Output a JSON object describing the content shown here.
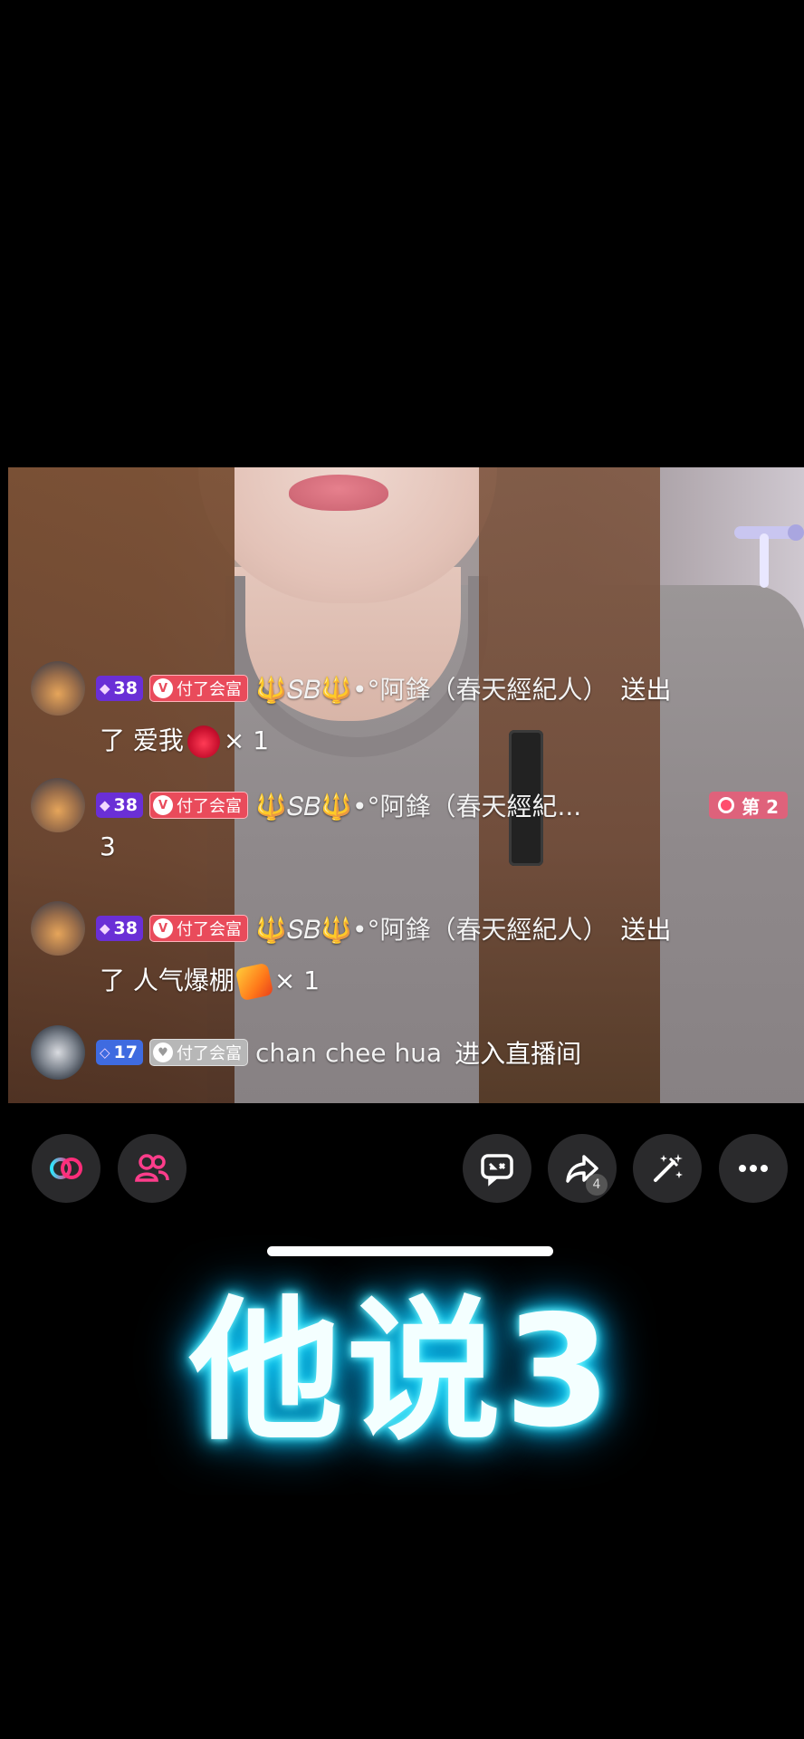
{
  "chat": [
    {
      "avatar": "sunset-avatar",
      "level": "38",
      "fan_badge": "付了会富",
      "username": "🔱𝑆𝐵🔱•°阿鋒（春天經紀人）",
      "action": "送出",
      "continuation": "了 爱我",
      "gift_icon": "love-gift-icon",
      "count": "× 1"
    },
    {
      "avatar": "sunset-avatar",
      "level": "38",
      "fan_badge": "付了会富",
      "username": "🔱𝑆𝐵🔱•°阿鋒（春天經紀...",
      "continuation": "3",
      "rank_badge": "第 2"
    },
    {
      "avatar": "sunset-avatar",
      "level": "38",
      "fan_badge": "付了会富",
      "username": "🔱𝑆𝐵🔱•°阿鋒（春天經紀人）",
      "action": "送出",
      "continuation": "了 人气爆棚",
      "gift_icon": "popular-gift-icon",
      "count": "× 1"
    },
    {
      "avatar": "car-avatar",
      "level": "17",
      "fan_badge": "付了会富",
      "username": "chan chee hua",
      "action": "进入直播间"
    }
  ],
  "toolbar": {
    "share_count": "4",
    "buttons": [
      "link-icon",
      "guests-icon",
      "comment-icon",
      "share-icon",
      "magic-wand-icon",
      "more-icon"
    ]
  },
  "caption": "他说3",
  "colors": {
    "caption_glow": "#29e6ff",
    "level_badge": "#6a2fd6",
    "level_badge_low": "#3f6be0",
    "fan_badge": "#e94b5b",
    "toolbar_button_bg": "#2a2a2c"
  }
}
